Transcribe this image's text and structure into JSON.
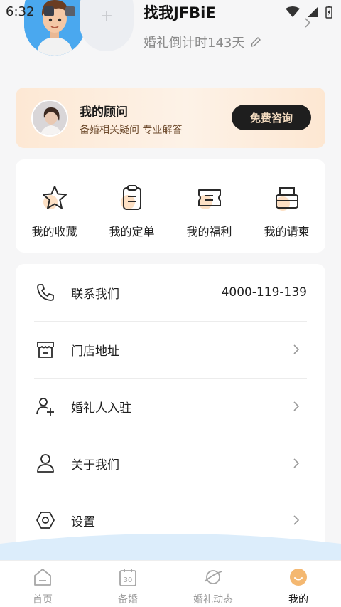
{
  "status_bar": {
    "time": "6:32"
  },
  "profile": {
    "username": "找我JFBiE",
    "countdown": "婚礼倒计时143天",
    "add_partner_symbol": "+"
  },
  "advisor": {
    "title": "我的顾问",
    "subtitle": "备婚相关疑问 专业解答",
    "button": "免费咨询"
  },
  "quick_actions": [
    {
      "label": "我的收藏",
      "icon": "star-icon"
    },
    {
      "label": "我的定单",
      "icon": "clipboard-icon"
    },
    {
      "label": "我的福利",
      "icon": "ticket-icon"
    },
    {
      "label": "我的请柬",
      "icon": "invitation-icon"
    }
  ],
  "menu": [
    {
      "label": "联系我们",
      "value": "4000-119-139",
      "icon": "phone-icon"
    },
    {
      "label": "门店地址",
      "icon": "store-icon"
    },
    {
      "label": "婚礼人入驻",
      "icon": "add-user-icon"
    },
    {
      "label": "关于我们",
      "icon": "person-icon"
    },
    {
      "label": "设置",
      "icon": "settings-icon"
    }
  ],
  "tabs": [
    {
      "label": "首页",
      "icon": "home-icon"
    },
    {
      "label": "备婚",
      "icon": "calendar-icon",
      "icon_text": "30"
    },
    {
      "label": "婚礼动态",
      "icon": "planet-icon"
    },
    {
      "label": "我的",
      "icon": "smile-icon",
      "active": true
    }
  ],
  "colors": {
    "accent_orange": "#f4b871",
    "advisor_bg": "#fde8d4",
    "button_dark": "#1e1e1e",
    "button_text": "#f4dcc0",
    "wave_blue": "#dcedfb"
  }
}
